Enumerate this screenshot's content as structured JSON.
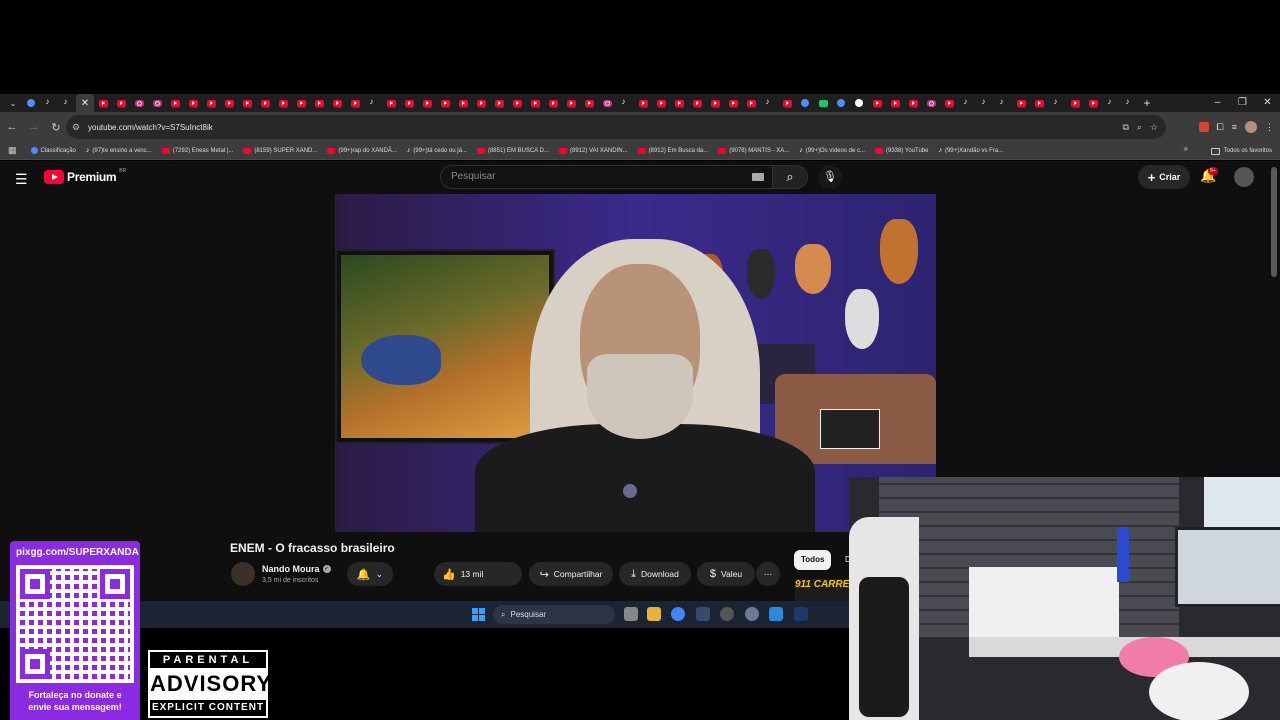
{
  "browser": {
    "url": "youtube.com/watch?v=S7SuInct8ik",
    "tab_favicons": [
      "blue",
      "tt",
      "tt",
      "active",
      "yt",
      "yt",
      "ig",
      "ig",
      "yt",
      "yt",
      "yt",
      "yt",
      "yt",
      "yt",
      "yt",
      "yt",
      "yt",
      "yt",
      "yt",
      "tt",
      "yt",
      "yt",
      "yt",
      "yt",
      "yt",
      "yt",
      "yt",
      "yt",
      "yt",
      "yt",
      "yt",
      "yt",
      "ig",
      "tt",
      "yt",
      "yt",
      "yt",
      "yt",
      "yt",
      "yt",
      "yt",
      "tt",
      "yt",
      "blue",
      "green",
      "blue",
      "g",
      "yt",
      "yt",
      "yt",
      "ig",
      "yt",
      "tt",
      "tt",
      "tt",
      "yt",
      "yt",
      "tt",
      "yt",
      "yt",
      "tt",
      "tt"
    ],
    "new_tab_label": "+",
    "window_controls": {
      "minimize": "–",
      "restore": "❐",
      "close": "✕"
    },
    "bookmarks": [
      {
        "icon": "blue",
        "label": "Classificação"
      },
      {
        "icon": "tt",
        "label": "(97)te ensino a venc..."
      },
      {
        "icon": "yt",
        "label": "(7292) Eneas Metal |..."
      },
      {
        "icon": "yt",
        "label": "(8159) SUPER XAND..."
      },
      {
        "icon": "yt",
        "label": "(99+)rap do XANDÃ..."
      },
      {
        "icon": "tt",
        "label": "(99+)tá cedo ou já..."
      },
      {
        "icon": "yt",
        "label": "(8851) EM BUSCA D..."
      },
      {
        "icon": "yt",
        "label": "(8912) VAI XANDIN..."
      },
      {
        "icon": "yt",
        "label": "(8912) Em Busca da..."
      },
      {
        "icon": "yt",
        "label": "(9078) MANTIS - XA..."
      },
      {
        "icon": "tt",
        "label": "(99+)Os vídeos de c..."
      },
      {
        "icon": "yt",
        "label": "(9338) YouTube"
      },
      {
        "icon": "tt",
        "label": "(99+)Xandão vs Fra..."
      }
    ],
    "bookmarks_more": "»",
    "all_bookmarks": "Todos os favoritos"
  },
  "youtube": {
    "brand": "Premium",
    "region": "BR",
    "search_placeholder": "Pesquisar",
    "create_label": "Criar",
    "notification_badge": "9+",
    "video_title": "ENEM - O fracasso brasileiro",
    "channel_name": "Nando Moura",
    "subscribers": "3,5 mi de inscritos",
    "likes": "13 mil",
    "share_label": "Compartilhar",
    "download_label": "Download",
    "thanks_label": "Valeu",
    "chip_all": "Todos",
    "chip_next": "D",
    "ad_text": "911 CARRE"
  },
  "taskbar": {
    "search_label": "Pesquisar"
  },
  "overlay": {
    "qr_url": "pixgg.com/SUPERXANDA",
    "qr_caption_line1": "Fortaleça no donate e",
    "qr_caption_line2": "envie sua mensagem!",
    "advisory_top": "PARENTAL",
    "advisory_mid": "ADVISORY",
    "advisory_bottom": "EXPLICIT CONTENT"
  },
  "colors": {
    "yt_red": "#ff0033",
    "qr_purple": "#8a2be2",
    "chrome_dark": "#3c3c3c"
  }
}
